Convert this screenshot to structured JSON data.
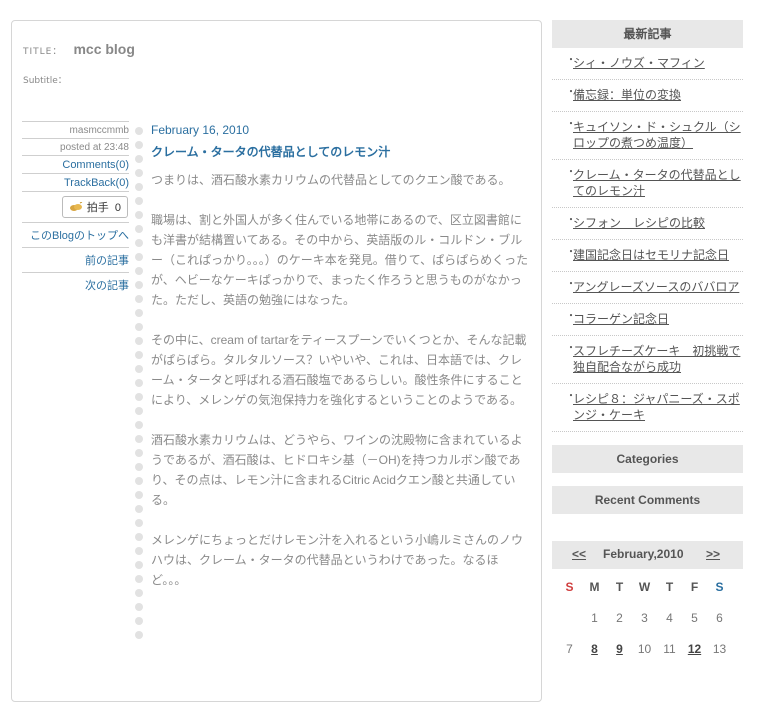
{
  "blog": {
    "title_label": "TITLE：",
    "title": "mcc blog",
    "subtitle_label": "Subtitle："
  },
  "meta": {
    "author": "masmccmmb",
    "posted": "posted at 23:48",
    "comments": "Comments(0)",
    "trackback": "TrackBack(0)",
    "clap_label": "拍手",
    "clap_count": "0",
    "top_link": "このBlogのトップへ",
    "prev_link": "前の記事",
    "next_link": "次の記事"
  },
  "post": {
    "date": "February 16, 2010",
    "title": "クレーム・タータの代替品としてのレモン汁",
    "paragraphs": [
      "つまりは、酒石酸水素カリウムの代替品としてのクエン酸である。",
      "職場は、割と外国人が多く住んでいる地帯にあるので、区立図書館にも洋書が結構置いてある。その中から、英語版のル・コルドン・ブルー（これぱっかり。。。）のケーキ本を発見。借りて、ぱらぱらめくったが、ヘビーなケーキぱっかりで、まったく作ろうと思うものがなかった。ただし、英語の勉強にはなった。",
      "その中に、cream of tartarをティースプーンでいくつとか、そんな記載がぱらぱら。タルタルソース？いやいや、これは、日本語では、クレーム・タータと呼ばれる酒石酸塩であるらしい。酸性条件にすることにより、メレンゲの気泡保持力を強化するということのようである。",
      "酒石酸水素カリウムは、どうやら、ワインの沈殿物に含まれているようであるが、酒石酸は、ヒドロキシ基（－OH)を持つカルボン酸であり、その点は、レモン汁に含まれるCitric Acidクエン酸と共通している。",
      "メレンゲにちょっとだけレモン汁を入れるという小嶋ルミさんのノウハウは、クレーム・タータの代替品というわけであった。なるほど。。。"
    ]
  },
  "sidebar": {
    "recent_title": "最新記事",
    "recent": [
      "シィ・ノウズ・マフィン",
      "備忘録：単位の変換",
      "キュイソン・ド・シュクル（シロップの煮つめ温度）",
      "クレーム・タータの代替品としてのレモン汁",
      "シフォン　レシピの比較",
      "建国記念日はセモリナ記念日",
      "アングレーズソースのババロア",
      "コラーゲン記念日",
      "スフレチーズケーキ　初挑戦で独自配合ながら成功",
      "レシピ８：ジャパニーズ・スポンジ・ケーキ"
    ],
    "categories_title": "Categories",
    "recent_comments_title": "Recent Comments"
  },
  "calendar": {
    "prev": "<<",
    "month": "February,2010",
    "next": ">>",
    "headers": [
      "S",
      "M",
      "T",
      "W",
      "T",
      "F",
      "S"
    ],
    "row1": [
      "",
      "1",
      "2",
      "3",
      "4",
      "5",
      "6"
    ],
    "row2": [
      "7",
      "8",
      "9",
      "10",
      "11",
      "12",
      "13"
    ]
  },
  "colors": {
    "link": "#2b6fa0",
    "gray_text": "#8a8a8a",
    "sunday": "#d04040"
  }
}
